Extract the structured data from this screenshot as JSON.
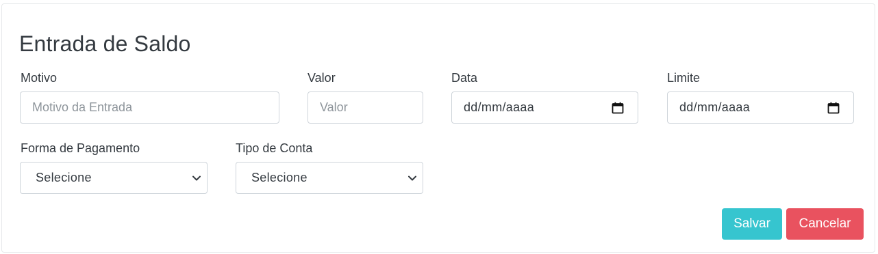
{
  "form": {
    "title": "Entrada de Saldo",
    "motivo": {
      "label": "Motivo",
      "placeholder": "Motivo da Entrada"
    },
    "valor": {
      "label": "Valor",
      "placeholder": "Valor"
    },
    "data": {
      "label": "Data",
      "value": "dd/mm/aaaa"
    },
    "limite": {
      "label": "Limite",
      "value": "dd/mm/aaaa"
    },
    "forma_pagamento": {
      "label": "Forma de Pagamento",
      "selected": "Selecione"
    },
    "tipo_conta": {
      "label": "Tipo de Conta",
      "selected": "Selecione"
    }
  },
  "actions": {
    "save_label": "Salvar",
    "cancel_label": "Cancelar"
  },
  "colors": {
    "save": "#36c5cf",
    "cancel": "#e9525f"
  }
}
